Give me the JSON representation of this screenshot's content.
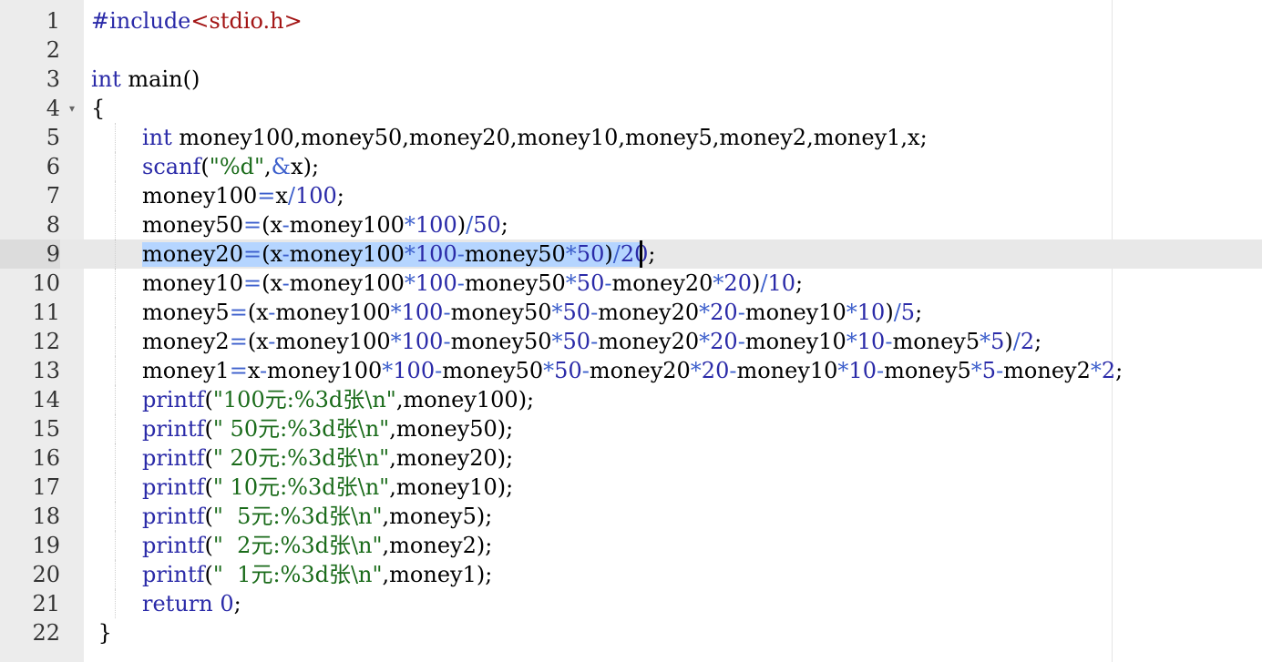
{
  "editor": {
    "active_line": 9,
    "fold_marker_line": 4,
    "lines": [
      {
        "n": "1",
        "indent": 0,
        "tokens": [
          [
            "pp",
            "#include"
          ],
          [
            "hd",
            "<stdio.h>"
          ]
        ]
      },
      {
        "n": "2",
        "indent": 0,
        "tokens": []
      },
      {
        "n": "3",
        "indent": 0,
        "tokens": [
          [
            "kw",
            "int"
          ],
          [
            "tx",
            " main()"
          ]
        ]
      },
      {
        "n": "4",
        "indent": 0,
        "tokens": [
          [
            "tx",
            "{"
          ]
        ]
      },
      {
        "n": "5",
        "indent": 1,
        "tokens": [
          [
            "kw",
            "int"
          ],
          [
            "tx",
            " money100,money50,money20,money10,money5,money2,money1,x;"
          ]
        ]
      },
      {
        "n": "6",
        "indent": 1,
        "tokens": [
          [
            "fn",
            "scanf"
          ],
          [
            "tx",
            "("
          ],
          [
            "str",
            "\"%d\""
          ],
          [
            "tx",
            ","
          ],
          [
            "op",
            "&"
          ],
          [
            "tx",
            "x);"
          ]
        ]
      },
      {
        "n": "7",
        "indent": 1,
        "tokens": [
          [
            "tx",
            "money100"
          ],
          [
            "op",
            "="
          ],
          [
            "tx",
            "x"
          ],
          [
            "op",
            "/"
          ],
          [
            "num",
            "100"
          ],
          [
            "tx",
            ";"
          ]
        ]
      },
      {
        "n": "8",
        "indent": 1,
        "tokens": [
          [
            "tx",
            "money50"
          ],
          [
            "op",
            "="
          ],
          [
            "tx",
            "(x"
          ],
          [
            "op",
            "-"
          ],
          [
            "tx",
            "money100"
          ],
          [
            "op",
            "*"
          ],
          [
            "num",
            "100"
          ],
          [
            "tx",
            ")"
          ],
          [
            "op",
            "/"
          ],
          [
            "num",
            "50"
          ],
          [
            "tx",
            ";"
          ]
        ]
      },
      {
        "n": "9",
        "indent": 1,
        "tokens": [
          [
            "tx",
            "money20"
          ],
          [
            "op",
            "="
          ],
          [
            "tx",
            "(x"
          ],
          [
            "op",
            "-"
          ],
          [
            "tx",
            "money100"
          ],
          [
            "op",
            "*"
          ],
          [
            "num",
            "100"
          ],
          [
            "op",
            "-"
          ],
          [
            "tx",
            "money50"
          ],
          [
            "op",
            "*"
          ],
          [
            "num",
            "50"
          ],
          [
            "tx",
            ")"
          ],
          [
            "op",
            "/"
          ],
          [
            "num",
            "20"
          ],
          [
            "tx",
            ";"
          ]
        ]
      },
      {
        "n": "10",
        "indent": 1,
        "tokens": [
          [
            "tx",
            "money10"
          ],
          [
            "op",
            "="
          ],
          [
            "tx",
            "(x"
          ],
          [
            "op",
            "-"
          ],
          [
            "tx",
            "money100"
          ],
          [
            "op",
            "*"
          ],
          [
            "num",
            "100"
          ],
          [
            "op",
            "-"
          ],
          [
            "tx",
            "money50"
          ],
          [
            "op",
            "*"
          ],
          [
            "num",
            "50"
          ],
          [
            "op",
            "-"
          ],
          [
            "tx",
            "money20"
          ],
          [
            "op",
            "*"
          ],
          [
            "num",
            "20"
          ],
          [
            "tx",
            ")"
          ],
          [
            "op",
            "/"
          ],
          [
            "num",
            "10"
          ],
          [
            "tx",
            ";"
          ]
        ]
      },
      {
        "n": "11",
        "indent": 1,
        "tokens": [
          [
            "tx",
            "money5"
          ],
          [
            "op",
            "="
          ],
          [
            "tx",
            "(x"
          ],
          [
            "op",
            "-"
          ],
          [
            "tx",
            "money100"
          ],
          [
            "op",
            "*"
          ],
          [
            "num",
            "100"
          ],
          [
            "op",
            "-"
          ],
          [
            "tx",
            "money50"
          ],
          [
            "op",
            "*"
          ],
          [
            "num",
            "50"
          ],
          [
            "op",
            "-"
          ],
          [
            "tx",
            "money20"
          ],
          [
            "op",
            "*"
          ],
          [
            "num",
            "20"
          ],
          [
            "op",
            "-"
          ],
          [
            "tx",
            "money10"
          ],
          [
            "op",
            "*"
          ],
          [
            "num",
            "10"
          ],
          [
            "tx",
            ")"
          ],
          [
            "op",
            "/"
          ],
          [
            "num",
            "5"
          ],
          [
            "tx",
            ";"
          ]
        ]
      },
      {
        "n": "12",
        "indent": 1,
        "tokens": [
          [
            "tx",
            "money2"
          ],
          [
            "op",
            "="
          ],
          [
            "tx",
            "(x"
          ],
          [
            "op",
            "-"
          ],
          [
            "tx",
            "money100"
          ],
          [
            "op",
            "*"
          ],
          [
            "num",
            "100"
          ],
          [
            "op",
            "-"
          ],
          [
            "tx",
            "money50"
          ],
          [
            "op",
            "*"
          ],
          [
            "num",
            "50"
          ],
          [
            "op",
            "-"
          ],
          [
            "tx",
            "money20"
          ],
          [
            "op",
            "*"
          ],
          [
            "num",
            "20"
          ],
          [
            "op",
            "-"
          ],
          [
            "tx",
            "money10"
          ],
          [
            "op",
            "*"
          ],
          [
            "num",
            "10"
          ],
          [
            "op",
            "-"
          ],
          [
            "tx",
            "money5"
          ],
          [
            "op",
            "*"
          ],
          [
            "num",
            "5"
          ],
          [
            "tx",
            ")"
          ],
          [
            "op",
            "/"
          ],
          [
            "num",
            "2"
          ],
          [
            "tx",
            ";"
          ]
        ]
      },
      {
        "n": "13",
        "indent": 1,
        "tokens": [
          [
            "tx",
            "money1"
          ],
          [
            "op",
            "="
          ],
          [
            "tx",
            "x"
          ],
          [
            "op",
            "-"
          ],
          [
            "tx",
            "money100"
          ],
          [
            "op",
            "*"
          ],
          [
            "num",
            "100"
          ],
          [
            "op",
            "-"
          ],
          [
            "tx",
            "money50"
          ],
          [
            "op",
            "*"
          ],
          [
            "num",
            "50"
          ],
          [
            "op",
            "-"
          ],
          [
            "tx",
            "money20"
          ],
          [
            "op",
            "*"
          ],
          [
            "num",
            "20"
          ],
          [
            "op",
            "-"
          ],
          [
            "tx",
            "money10"
          ],
          [
            "op",
            "*"
          ],
          [
            "num",
            "10"
          ],
          [
            "op",
            "-"
          ],
          [
            "tx",
            "money5"
          ],
          [
            "op",
            "*"
          ],
          [
            "num",
            "5"
          ],
          [
            "op",
            "-"
          ],
          [
            "tx",
            "money2"
          ],
          [
            "op",
            "*"
          ],
          [
            "num",
            "2"
          ],
          [
            "tx",
            ";"
          ]
        ]
      },
      {
        "n": "14",
        "indent": 1,
        "tokens": [
          [
            "fn",
            "printf"
          ],
          [
            "tx",
            "("
          ],
          [
            "str",
            "\"100元:%3d张\\n\""
          ],
          [
            "tx",
            ",money100);"
          ]
        ]
      },
      {
        "n": "15",
        "indent": 1,
        "tokens": [
          [
            "fn",
            "printf"
          ],
          [
            "tx",
            "("
          ],
          [
            "str",
            "\" 50元:%3d张\\n\""
          ],
          [
            "tx",
            ",money50);"
          ]
        ]
      },
      {
        "n": "16",
        "indent": 1,
        "tokens": [
          [
            "fn",
            "printf"
          ],
          [
            "tx",
            "("
          ],
          [
            "str",
            "\" 20元:%3d张\\n\""
          ],
          [
            "tx",
            ",money20);"
          ]
        ]
      },
      {
        "n": "17",
        "indent": 1,
        "tokens": [
          [
            "fn",
            "printf"
          ],
          [
            "tx",
            "("
          ],
          [
            "str",
            "\" 10元:%3d张\\n\""
          ],
          [
            "tx",
            ",money10);"
          ]
        ]
      },
      {
        "n": "18",
        "indent": 1,
        "tokens": [
          [
            "fn",
            "printf"
          ],
          [
            "tx",
            "("
          ],
          [
            "str",
            "\"  5元:%3d张\\n\""
          ],
          [
            "tx",
            ",money5);"
          ]
        ]
      },
      {
        "n": "19",
        "indent": 1,
        "tokens": [
          [
            "fn",
            "printf"
          ],
          [
            "tx",
            "("
          ],
          [
            "str",
            "\"  2元:%3d张\\n\""
          ],
          [
            "tx",
            ",money2);"
          ]
        ]
      },
      {
        "n": "20",
        "indent": 1,
        "tokens": [
          [
            "fn",
            "printf"
          ],
          [
            "tx",
            "("
          ],
          [
            "str",
            "\"  1元:%3d张\\n\""
          ],
          [
            "tx",
            ",money1);"
          ]
        ]
      },
      {
        "n": "21",
        "indent": 1,
        "tokens": [
          [
            "kw",
            "return"
          ],
          [
            "tx",
            " "
          ],
          [
            "num",
            "0"
          ],
          [
            "tx",
            ";"
          ]
        ]
      },
      {
        "n": "22",
        "indent": 0,
        "tokens": [
          [
            "tx",
            " }"
          ]
        ]
      }
    ]
  },
  "icons": {
    "fold_marker": "chevron-down-icon",
    "fold_glyph": "▾"
  },
  "colors": {
    "gutter": "#ececec",
    "active_line": "#e8e8e8",
    "selection": "#b5d5ff",
    "keyword": "#2a2aa8",
    "string": "#1a6b1a",
    "header": "#a31515",
    "operator": "#3c5fcc"
  }
}
